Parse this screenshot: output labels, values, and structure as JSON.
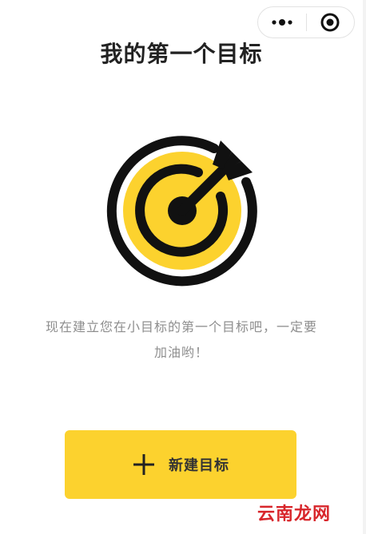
{
  "header": {
    "title": "我的第一个目标"
  },
  "capsule": {
    "more_icon": "more-dots-icon",
    "close_icon": "target-circle-icon"
  },
  "illustration": {
    "icon": "target-arrow-icon",
    "colors": {
      "ring": "#111111",
      "fill": "#fcd22e"
    }
  },
  "description": {
    "line1": "现在建立您在小目标的第一个目标吧，一定要",
    "line2": "加油哟！"
  },
  "new_goal_button": {
    "label": "新建目标",
    "icon": "plus-icon",
    "color": "#fcd22e"
  },
  "watermark": {
    "text": "云南龙网"
  }
}
